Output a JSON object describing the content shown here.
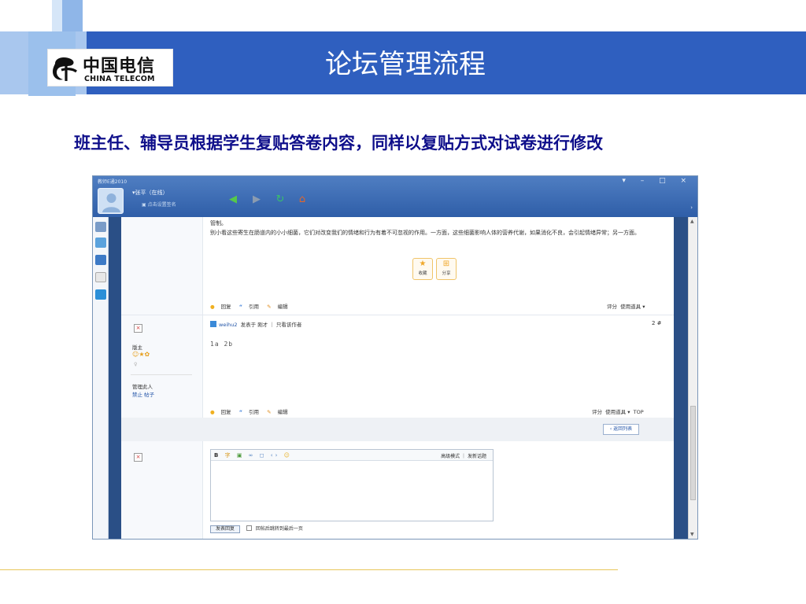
{
  "slide": {
    "title": "论坛管理流程",
    "subtitle": "班主任、辅导员根据学生复贴答卷内容，同样以复贴方式对试卷进行修改"
  },
  "logo": {
    "chinese": "中国电信",
    "english": "CHINA TELECOM",
    "color": "#1a1a1a"
  },
  "theme": {
    "title_bar": "#2f5fbf",
    "subtitle_color": "#0e0e8a",
    "frame_blue": "#2a4f86",
    "accent_line": "#e8c65a"
  },
  "app": {
    "window_title": "教师E通2010",
    "window_controls": "▾ – □ ×",
    "user": {
      "name": "▾张平（在线）",
      "signature": "▣ 点击设置签名"
    },
    "nav_icons": [
      "back-arrow-icon",
      "forward-arrow-icon",
      "refresh-icon",
      "home-icon"
    ],
    "post1": {
      "text": "管制。\n别小看这些寄生在肠道内的小小细菌，它们对改变我们的情绪和行为有着不可忽视的作用。一方面，这些细菌影响人体的营养代谢，如果消化不良，会引起情绪异常；另一方面。",
      "fav_label": "收藏",
      "share_label": "分享",
      "actions": {
        "reply": "回复",
        "quote": "引用",
        "edit": "编辑",
        "rate": "评分",
        "tools": "使用道具 ▾"
      }
    },
    "post2": {
      "username": "weihu2",
      "meta": "发表于 刚才 ｜ 只看该作者",
      "floor": "2 #",
      "body": "1a  2b",
      "author_role": "版主",
      "manage_label": "管理此人",
      "manage_links": "禁止  帖子",
      "actions": {
        "reply": "回复",
        "quote": "引用",
        "edit": "编辑",
        "rate": "评分",
        "tools": "使用道具 ▾",
        "top": "TOP"
      }
    },
    "back_to_list": "‹ 返回列表",
    "editor": {
      "toolbar": "B 字 ≡ ∞ ◻ ‹› ☺",
      "advanced_mode": "高级模式",
      "separator": "｜",
      "new_topic": "发新话题",
      "submit": "发表回复",
      "checkbox_label": "回帖后跳转到最后一页"
    }
  }
}
